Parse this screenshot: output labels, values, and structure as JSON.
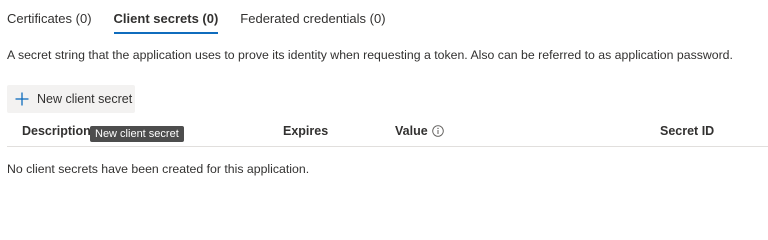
{
  "tabs": [
    {
      "label": "Certificates (0)",
      "active": false
    },
    {
      "label": "Client secrets (0)",
      "active": true
    },
    {
      "label": "Federated credentials (0)",
      "active": false
    }
  ],
  "description": "A secret string that the application uses to prove its identity when requesting a token. Also can be referred to as application password.",
  "toolbar": {
    "new_secret_label": "New client secret",
    "plus_icon": "plus-icon"
  },
  "tooltip": {
    "text": "New client secret"
  },
  "table": {
    "columns": {
      "description": "Description",
      "expires": "Expires",
      "value": "Value",
      "secret_id": "Secret ID"
    },
    "value_info_icon": "info-icon",
    "empty_message": "No client secrets have been created for this application."
  },
  "colors": {
    "accent": "#0f6cbd",
    "text": "#323130",
    "button_bg": "#f3f2f1",
    "tooltip_bg": "#4d4d4d",
    "divider": "#e1dfdd"
  }
}
